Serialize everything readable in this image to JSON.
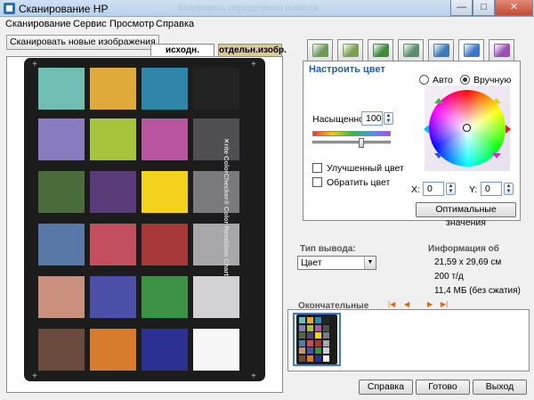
{
  "window": {
    "title": "Сканирование HP",
    "ghost_title": "Копировать определения новости",
    "minimize": "—",
    "maximize": "□",
    "close": "✕"
  },
  "menu": [
    "Сканирование",
    "Сервис",
    "Просмотр",
    "Справка"
  ],
  "left": {
    "scan_new_button": "Сканировать новые изображения",
    "view_tabs": [
      "исходн. изобр.",
      "отдельн.изобр."
    ],
    "active_view_tab": 1
  },
  "chart": {
    "text": "✕rite ColorChecker® Color Rendition Chart",
    "patches": [
      [
        "#6fbdb3",
        "#e0aa3a",
        "#2f86a8",
        "#232323"
      ],
      [
        "#8a7bbf",
        "#a6c33c",
        "#b8559e",
        "#4f4f53"
      ],
      [
        "#4a6b3a",
        "#5a3b7a",
        "#f3d21e",
        "#7a7a7c"
      ],
      [
        "#5878a8",
        "#c24e5e",
        "#a8373a",
        "#a8a8aa"
      ],
      [
        "#c9907e",
        "#4c4fa8",
        "#3c9144",
        "#d2d2d4"
      ],
      [
        "#6a4a3c",
        "#d67c2c",
        "#2c3090",
        "#f7f7f7"
      ]
    ]
  },
  "tool_tabs": [
    {
      "icon": "scan-image-icon",
      "color": "#6f9a5b"
    },
    {
      "icon": "resize-icon",
      "color": "#7aa050"
    },
    {
      "icon": "crop-icon",
      "color": "#3f8a3f"
    },
    {
      "icon": "image-adjust-icon",
      "color": "#5a8f6a"
    },
    {
      "icon": "export-icon",
      "color": "#3d7ab8"
    },
    {
      "icon": "color-adjust-icon",
      "color": "#3b78c8"
    },
    {
      "icon": "sharpen-icon",
      "color": "#9a4fb0"
    }
  ],
  "active_tool_tab": 5,
  "color_panel": {
    "title": "Настроить цвет",
    "saturation_label": "Насыщенност",
    "saturation_value": "100",
    "saturation_level": 0.62,
    "improved_color_label": "Улучшенный цвет",
    "invert_color_label": "Обратить цвет",
    "auto_label": "Авто",
    "manual_label": "Вручную",
    "mode": "manual",
    "x_label": "X:",
    "x_value": "0",
    "y_label": "Y:",
    "y_value": "0",
    "optimal_button": "Оптимальные значения"
  },
  "output": {
    "type_label": "Тип вывода:",
    "type_value": "Цвет"
  },
  "info": {
    "label": "Информация об",
    "size": "21,59 x 29,69 см",
    "dpi": "200 т/д",
    "filesize": "11,4 МБ (без сжатия)"
  },
  "finals": {
    "label": "Окончательные",
    "nav": [
      "|◀",
      "◀",
      "▶",
      "▶|"
    ]
  },
  "footer": {
    "help": "Справка",
    "done": "Готово",
    "exit": "Выход"
  }
}
